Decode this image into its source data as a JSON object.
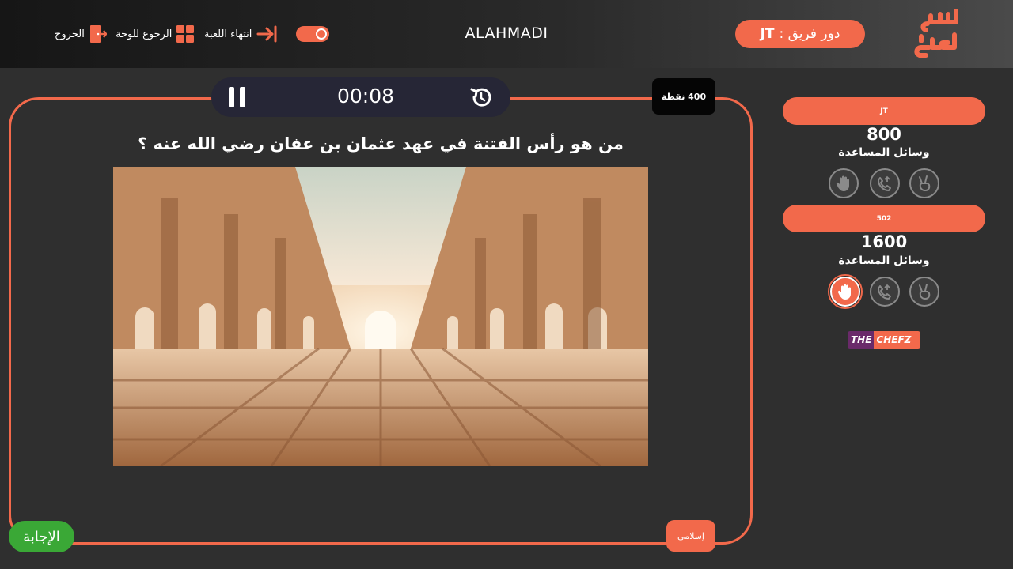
{
  "header": {
    "turn_label": "دور فريق :",
    "turn_team": "JT",
    "game_name": "ALAHMADI",
    "nav": {
      "exit_label": "الخروج",
      "board_label": "الرجوع للوحة",
      "end_label": "انتهاء اللعبة"
    }
  },
  "timer": {
    "value": "00:08"
  },
  "question": {
    "points": "400 نقطة",
    "text": "من هو رأس الفتنة في عهد عثمان بن عفان رضي الله عنه ؟",
    "category": "إسلامي",
    "answer_label": "الإجابة",
    "image_icon": "arabesque-hall-image"
  },
  "teams": [
    {
      "name": "JT",
      "score": "800",
      "help_label": "وسائل المساعدة",
      "helps": [
        {
          "icon": "hand-stop-icon",
          "used": false
        },
        {
          "icon": "phone-call-icon",
          "used": false
        },
        {
          "icon": "peace-hand-icon",
          "used": false
        }
      ]
    },
    {
      "name": "502",
      "score": "1600",
      "help_label": "وسائل المساعدة",
      "helps": [
        {
          "icon": "hand-stop-icon",
          "used": true
        },
        {
          "icon": "phone-call-icon",
          "used": false
        },
        {
          "icon": "peace-hand-icon",
          "used": false
        }
      ]
    }
  ],
  "sponsor": {
    "part1": "THE",
    "part2": "CHEFZ"
  },
  "colors": {
    "accent": "#f2694b",
    "answer": "#3aa836",
    "timer_bg": "#262636",
    "bg": "#2f2f2f"
  }
}
